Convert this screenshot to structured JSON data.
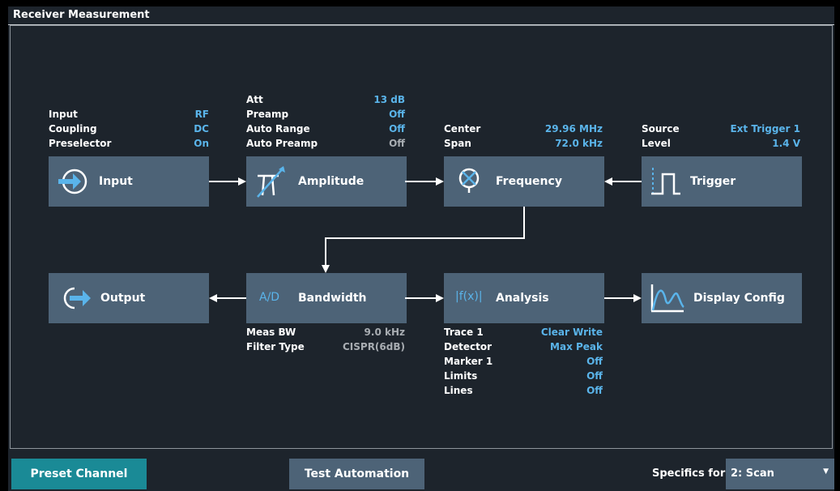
{
  "window": {
    "title": "Receiver Measurement"
  },
  "blocks": {
    "input": {
      "label": "Input",
      "icon": "input-arrow-icon"
    },
    "amplitude": {
      "label": "Amplitude",
      "icon": "attenuator-icon"
    },
    "frequency": {
      "label": "Frequency",
      "icon": "mixer-icon"
    },
    "trigger": {
      "label": "Trigger",
      "icon": "pulse-icon"
    },
    "output": {
      "label": "Output",
      "icon": "output-arrow-icon"
    },
    "bandwidth": {
      "label": "Bandwidth",
      "icon_text": "A/D"
    },
    "analysis": {
      "label": "Analysis",
      "icon_text": "|f(x)|"
    },
    "display": {
      "label": "Display Config",
      "icon": "waveform-icon"
    }
  },
  "input_info": [
    {
      "key": "Input",
      "value": "RF"
    },
    {
      "key": "Coupling",
      "value": "DC"
    },
    {
      "key": "Preselector",
      "value": "On"
    }
  ],
  "amplitude_info": [
    {
      "key": "Att",
      "value": "13 dB"
    },
    {
      "key": "Preamp",
      "value": "Off"
    },
    {
      "key": "Auto Range",
      "value": "Off"
    },
    {
      "key": "Auto Preamp",
      "value": "Off"
    }
  ],
  "frequency_info": [
    {
      "key": "Center",
      "value": "29.96 MHz"
    },
    {
      "key": "Span",
      "value": "72.0 kHz"
    }
  ],
  "trigger_info": [
    {
      "key": "Source",
      "value": "Ext Trigger 1"
    },
    {
      "key": "Level",
      "value": "1.4 V"
    }
  ],
  "bandwidth_info": [
    {
      "key": "Meas BW",
      "value": "9.0 kHz"
    },
    {
      "key": "Filter Type",
      "value": "CISPR(6dB)"
    }
  ],
  "analysis_info": [
    {
      "key": "Trace 1",
      "value": "Clear Write"
    },
    {
      "key": "Detector",
      "value": "Max Peak"
    },
    {
      "key": "Marker 1",
      "value": "Off"
    },
    {
      "key": "Limits",
      "value": "Off"
    },
    {
      "key": "Lines",
      "value": "Off"
    }
  ],
  "footer": {
    "preset_label": "Preset Channel",
    "test_automation_label": "Test Automation",
    "specifics_label": "Specifics for",
    "specifics_value": "2: Scan"
  },
  "colors": {
    "accent": "#5ab4ea",
    "block": "#4d6377",
    "background": "#1d242c",
    "preset": "#1a8a96"
  }
}
